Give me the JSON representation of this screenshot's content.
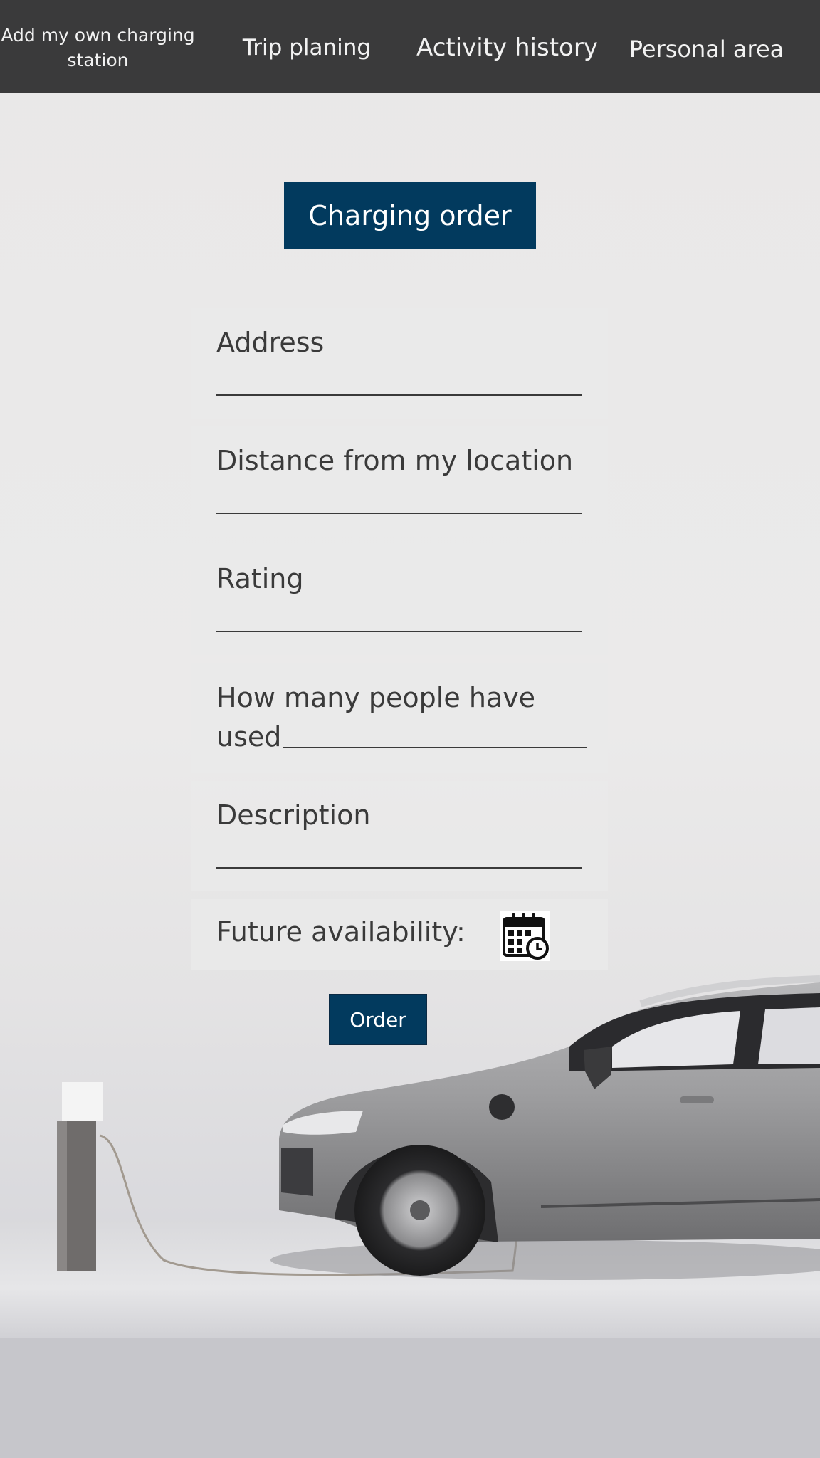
{
  "nav": {
    "items": [
      {
        "label_line1": "Add my own charging",
        "label_line2": "station"
      },
      {
        "label": "Trip planing"
      },
      {
        "label": "Activity history"
      },
      {
        "label": "Personal area"
      }
    ]
  },
  "header": {
    "title": "Charging order"
  },
  "form": {
    "address_label": "Address",
    "distance_label": "Distance from my location",
    "rating_label": "Rating",
    "people_label_line1": "How many people have",
    "people_label_line2": "used",
    "description_label": "Description",
    "availability_label": "Future availability:",
    "calendar_icon": "calendar-clock-icon",
    "order_label": "Order"
  },
  "colors": {
    "topbar": "#3a3a3b",
    "accent": "#023a5e",
    "card": "#e9e9e9",
    "text": "#3a3a3a"
  }
}
